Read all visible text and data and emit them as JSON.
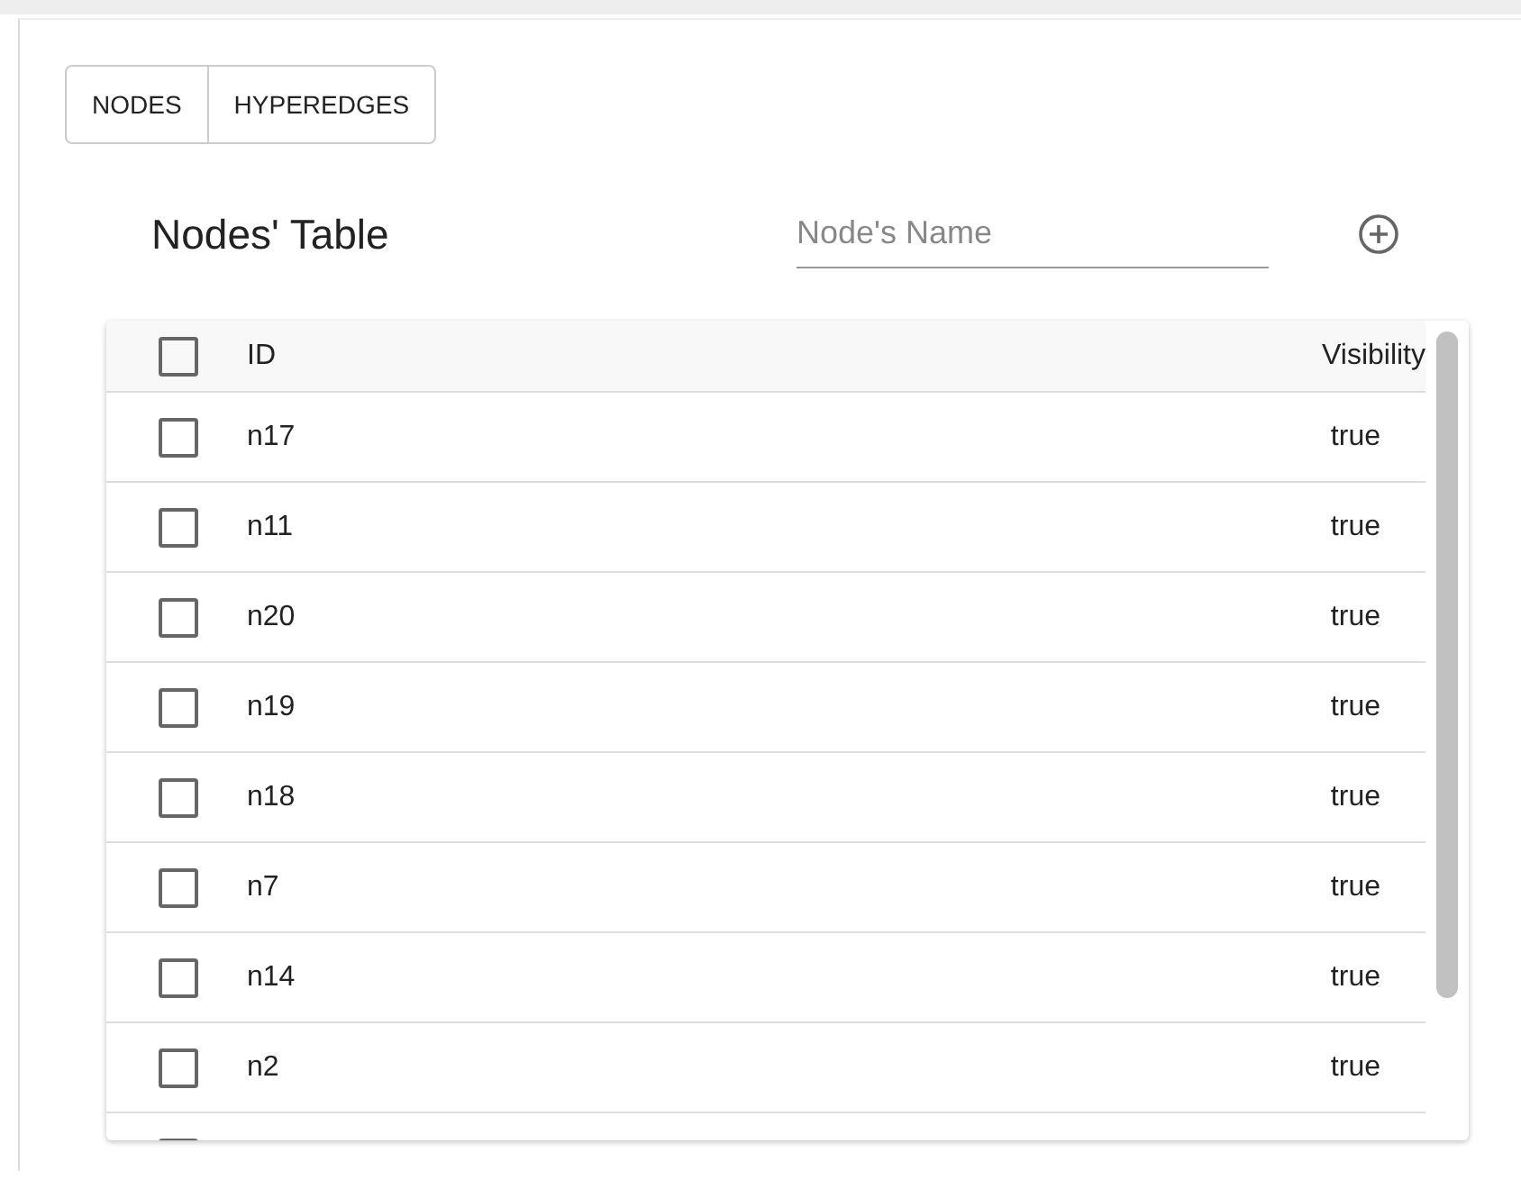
{
  "tabs": [
    {
      "label": "NODES",
      "selected": false
    },
    {
      "label": "HYPEREDGES",
      "selected": false
    }
  ],
  "title": "Nodes' Table",
  "search": {
    "placeholder": "Node's Name"
  },
  "table": {
    "header_checked": false,
    "columns": [
      "ID",
      "Visibility"
    ],
    "rows": [
      {
        "checked": false,
        "id": "n17",
        "visibility": "true"
      },
      {
        "checked": false,
        "id": "n11",
        "visibility": "true"
      },
      {
        "checked": false,
        "id": "n20",
        "visibility": "true"
      },
      {
        "checked": false,
        "id": "n19",
        "visibility": "true"
      },
      {
        "checked": false,
        "id": "n18",
        "visibility": "true"
      },
      {
        "checked": false,
        "id": "n7",
        "visibility": "true"
      },
      {
        "checked": false,
        "id": "n14",
        "visibility": "true"
      },
      {
        "checked": false,
        "id": "n2",
        "visibility": "true"
      },
      {
        "checked": false
      }
    ]
  }
}
